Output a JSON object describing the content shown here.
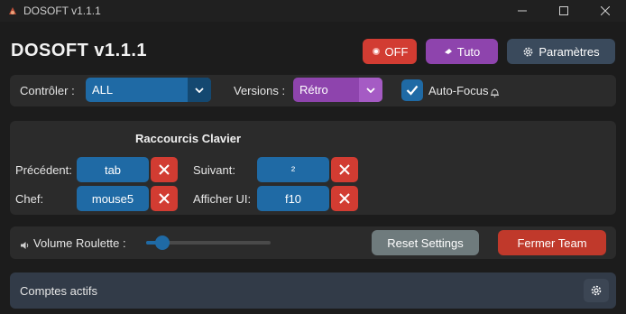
{
  "window": {
    "title": "DOSOFT v1.1.1"
  },
  "header": {
    "app_title": "DOSOFT v1.1.1",
    "off_label": "OFF",
    "tuto_label": "Tuto",
    "settings_label": "Paramètres"
  },
  "controls": {
    "controller_label": "Contrôler :",
    "controller_value": "ALL",
    "versions_label": "Versions :",
    "versions_value": "Rétro",
    "autofocus_label": "Auto-Focus",
    "autofocus_checked": true
  },
  "shortcuts": {
    "title": "Raccourcis Clavier",
    "previous_label": "Précédent:",
    "previous_key": "tab",
    "next_label": "Suivant:",
    "next_key": "²",
    "chief_label": "Chef:",
    "chief_key": "mouse5",
    "show_ui_label": "Afficher UI:",
    "show_ui_key": "f10"
  },
  "volume": {
    "label": "Volume Roulette :",
    "level_percent": 13,
    "reset_label": "Reset Settings",
    "close_team_label": "Fermer Team"
  },
  "accounts": {
    "label": "Comptes actifs"
  },
  "colors": {
    "accent_blue": "#1f6aa5",
    "danger_red": "#d23c32",
    "purple": "#8e44ad",
    "slate": "#3a4a5c",
    "gray_button": "#6f7b7d",
    "background": "#1c1c1c",
    "frame": "#2b2b2b"
  }
}
